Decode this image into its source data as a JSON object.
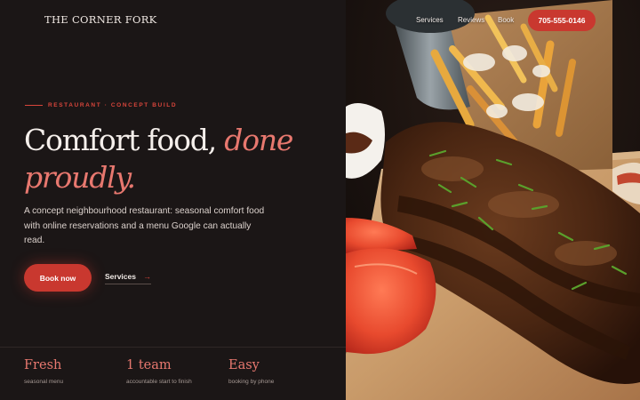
{
  "brand": {
    "name": "THE CORNER FORK"
  },
  "nav": {
    "items": [
      {
        "label": "Services"
      },
      {
        "label": "Reviews"
      },
      {
        "label": "Book"
      }
    ],
    "phone": "705-555-0146"
  },
  "hero": {
    "eyebrow": "RESTAURANT · CONCEPT BUILD",
    "headline_plain": "Comfort food,",
    "headline_accent_1": "done",
    "headline_accent_2": "proudly.",
    "lede": "A concept neighbourhood restaurant: seasonal comfort food with online reservations and a menu Google can actually read.",
    "cta_primary": "Book now",
    "cta_secondary": "Services",
    "cta_secondary_icon": "arrow-right-icon"
  },
  "stats": [
    {
      "value": "Fresh",
      "label": "seasonal menu"
    },
    {
      "value": "1 team",
      "label": "accountable start to finish"
    },
    {
      "value": "Easy",
      "label": "booking by phone"
    }
  ],
  "colors": {
    "accent": "#c9382f",
    "accent_text": "#e8786f",
    "background": "#1b1616"
  },
  "image": {
    "subject": "ribs-fries-photo"
  }
}
